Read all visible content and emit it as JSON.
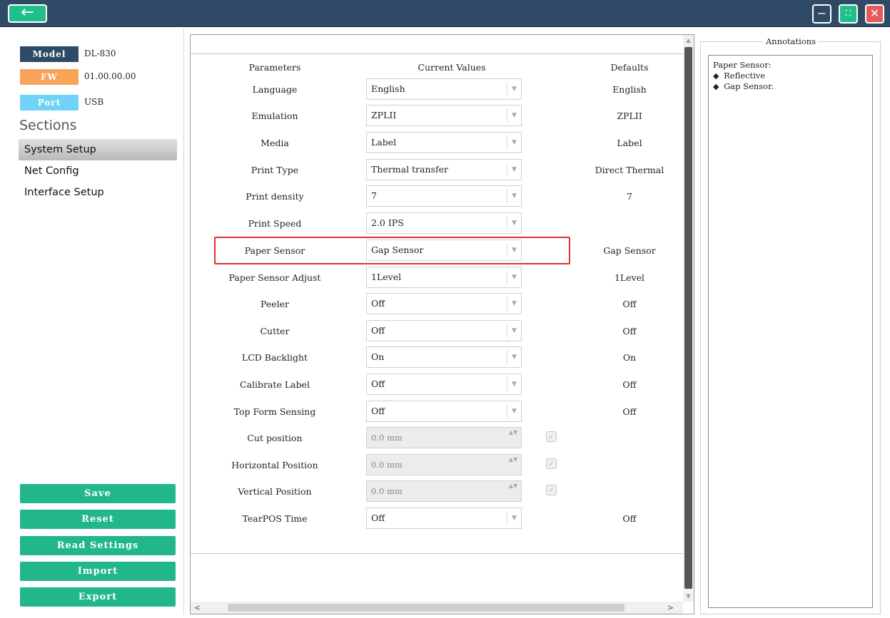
{
  "titlebar": {
    "back_icon": "←",
    "minimize_icon": "−",
    "maximize_icon": "⛶",
    "close_icon": "✕"
  },
  "device": {
    "model_label": "Model",
    "model_value": "DL-830",
    "fw_label": "FW",
    "fw_value": "01.00.00.00",
    "port_label": "Port",
    "port_value": "USB"
  },
  "sidebar": {
    "sections_title": "Sections",
    "items": [
      {
        "label": "System Setup"
      },
      {
        "label": "Net Config"
      },
      {
        "label": "Interface Setup"
      }
    ],
    "buttons": {
      "save": "Save",
      "reset": "Reset",
      "read_settings": "Read Settings",
      "import": "Import",
      "export": "Export"
    }
  },
  "table": {
    "headers": {
      "parameters": "Parameters",
      "current": "Current Values",
      "defaults": "Defaults"
    },
    "rows": [
      {
        "param": "Language",
        "value": "English",
        "default": "English"
      },
      {
        "param": "Emulation",
        "value": "ZPLII",
        "default": "ZPLII"
      },
      {
        "param": "Media",
        "value": "Label",
        "default": "Label"
      },
      {
        "param": "Print Type",
        "value": "Thermal transfer",
        "default": "Direct Thermal"
      },
      {
        "param": "Print density",
        "value": "7",
        "default": "7"
      },
      {
        "param": "Print Speed",
        "value": "2.0 IPS",
        "default": ""
      },
      {
        "param": "Paper Sensor",
        "value": "Gap Sensor",
        "default": "Gap Sensor"
      },
      {
        "param": "Paper Sensor Adjust",
        "value": "1Level",
        "default": "1Level"
      },
      {
        "param": "Peeler",
        "value": "Off",
        "default": "Off"
      },
      {
        "param": "Cutter",
        "value": "Off",
        "default": "Off"
      },
      {
        "param": "LCD Backlight",
        "value": "On",
        "default": "On"
      },
      {
        "param": "Calibrate Label",
        "value": "Off",
        "default": "Off"
      },
      {
        "param": "Top Form Sensing",
        "value": "Off",
        "default": "Off"
      },
      {
        "param": "Cut position",
        "value": "0.0 mm",
        "default": ""
      },
      {
        "param": "Horizontal Position",
        "value": "0.0 mm",
        "default": ""
      },
      {
        "param": "Vertical Position",
        "value": "0.0 mm",
        "default": ""
      },
      {
        "param": "TearPOS Time",
        "value": "Off",
        "default": "Off"
      }
    ],
    "dropdown_icon": "▼",
    "spin_icon": "▲▼",
    "check_icon": "✓"
  },
  "annotations": {
    "title": "Annotations",
    "heading": "Paper Sensor:",
    "bullets": [
      "Reflective",
      "Gap Sensor."
    ],
    "bullet_icon": "◆"
  },
  "scroll": {
    "up_icon": "▲",
    "down_icon": "▼",
    "left_icon": "<",
    "right_icon": ">"
  }
}
